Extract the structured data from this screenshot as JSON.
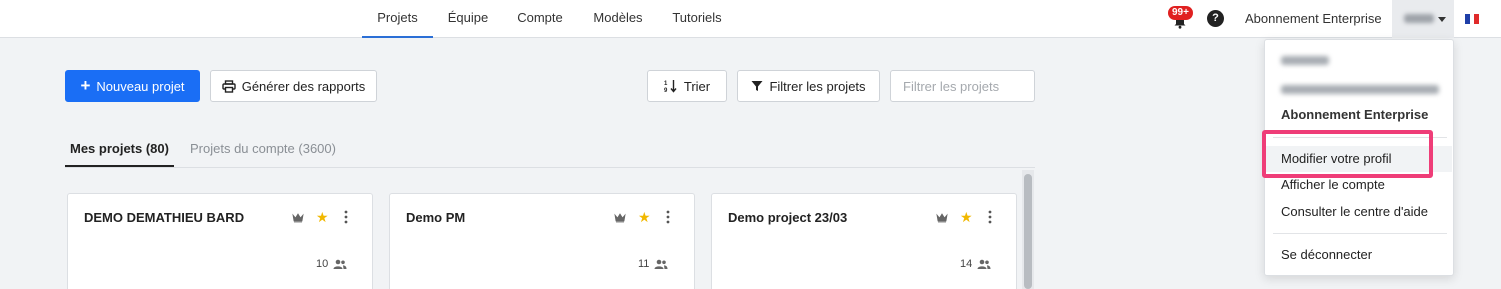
{
  "nav": {
    "tabs": [
      {
        "label": "Projets",
        "active": true
      },
      {
        "label": "Équipe",
        "active": false
      },
      {
        "label": "Compte",
        "active": false
      },
      {
        "label": "Modèles",
        "active": false
      },
      {
        "label": "Tutoriels",
        "active": false
      }
    ],
    "notifications_badge": "99+",
    "help_icon": "question-icon",
    "plan_label": "Abonnement Enterprise",
    "language_flag": "flag-fr-icon"
  },
  "toolbar": {
    "new_project_label": "Nouveau projet",
    "reports_label": "Générer des rapports",
    "sort_label": "Trier",
    "filter_label": "Filtrer les projets",
    "filter_placeholder": "Filtrer les projets"
  },
  "subtabs": {
    "my_projects": "Mes projets (80)",
    "account_projects": "Projets du compte (3600)"
  },
  "projects": [
    {
      "name": "DEMO DEMATHIEU BARD",
      "members": "10",
      "starred": true
    },
    {
      "name": "Demo PM",
      "members": "11",
      "starred": true
    },
    {
      "name": "Demo project 23/03",
      "members": "14",
      "starred": true
    }
  ],
  "dropdown": {
    "plan": "Abonnement Enterprise",
    "edit_profile": "Modifier votre profil",
    "view_account": "Afficher le compte",
    "help_center": "Consulter le centre d'aide",
    "logout": "Se déconnecter"
  },
  "colors": {
    "primary": "#1a6ef5",
    "active_tab": "#2b6fd6",
    "star": "#f1b800",
    "badge": "#e02020",
    "highlight": "#ef3d78"
  }
}
